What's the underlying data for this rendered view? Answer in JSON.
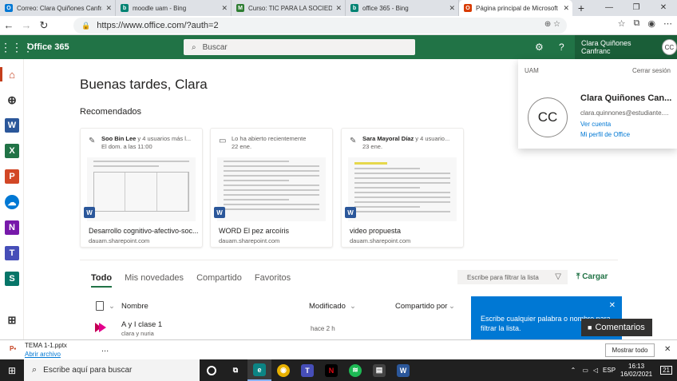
{
  "browser": {
    "tabs": [
      {
        "title": "Correo: Clara Quiñones Canfran",
        "favicon": "outlook-icon",
        "color": "#0078d4",
        "glyph": "O"
      },
      {
        "title": "moodle uam - Bing",
        "favicon": "bing-icon",
        "color": "#008373",
        "glyph": "b"
      },
      {
        "title": "Curso: TIC PARA LA SOCIEDAD",
        "favicon": "course-icon",
        "color": "#2e7d32",
        "glyph": "M"
      },
      {
        "title": "office 365 - Bing",
        "favicon": "bing-icon",
        "color": "#008373",
        "glyph": "b"
      },
      {
        "title": "Página principal de Microsoft O",
        "favicon": "office-icon",
        "color": "#d83b01",
        "glyph": "O",
        "active": true
      }
    ],
    "new_tab": "+",
    "url": "https://www.office.com/?auth=2"
  },
  "o365": {
    "brand": "Office 365",
    "search_placeholder": "Buscar",
    "user_name": "Clara Quiñones Canfranc",
    "user_initials": "CC"
  },
  "main": {
    "greeting": "Buenas tardes, Clara",
    "recommended_title": "Recomendados",
    "cards": [
      {
        "who": "Soo Bin Lee",
        "action": " y 4 usuarios más l...",
        "when": "El dom. a las 11:00",
        "name": "Desarrollo cognitivo-afectivo-soc...",
        "site": "dauam.sharepoint.com",
        "icon": "edit-icon"
      },
      {
        "who": "",
        "action": "Lo ha abierto recientemente",
        "when": "22 ene.",
        "name": "WORD El pez arcoíris",
        "site": "dauam.sharepoint.com",
        "icon": "folder-icon"
      },
      {
        "who": "Sara Mayoral Díaz",
        "action": " y 4 usuario...",
        "when": "23 ene.",
        "name": "video propuesta",
        "site": "dauam.sharepoint.com",
        "icon": "edit-icon"
      }
    ],
    "tabs": [
      "Todo",
      "Mis novedades",
      "Compartido",
      "Favoritos"
    ],
    "filter_placeholder": "Escribe para filtrar la lista",
    "upload_label": "Cargar",
    "columns": {
      "name": "Nombre",
      "modified": "Modificado",
      "shared_by": "Compartido por"
    },
    "rows": [
      {
        "name": "A y I clase 1",
        "sub": "clara y nuria",
        "modified": "hace 2 h"
      }
    ]
  },
  "bubble": {
    "text": "Escribe cualquier palabra o nombre para filtrar la lista."
  },
  "comments_button": "Comentarios",
  "flyout": {
    "org": "UAM",
    "signout": "Cerrar sesión",
    "initials": "CC",
    "name": "Clara Quiñones Can...",
    "email": "clara.quinnones@estudiante....",
    "view_account": "Ver cuenta",
    "profile": "Mi perfil de Office"
  },
  "download": {
    "file": "TEMA 1-1.pptx",
    "open": "Abrir archivo",
    "show_all": "Mostrar todo",
    "more": "..."
  },
  "taskbar": {
    "search_placeholder": "Escribe aquí para buscar",
    "time": "16:13",
    "date": "16/02/2021",
    "notif": "21"
  }
}
